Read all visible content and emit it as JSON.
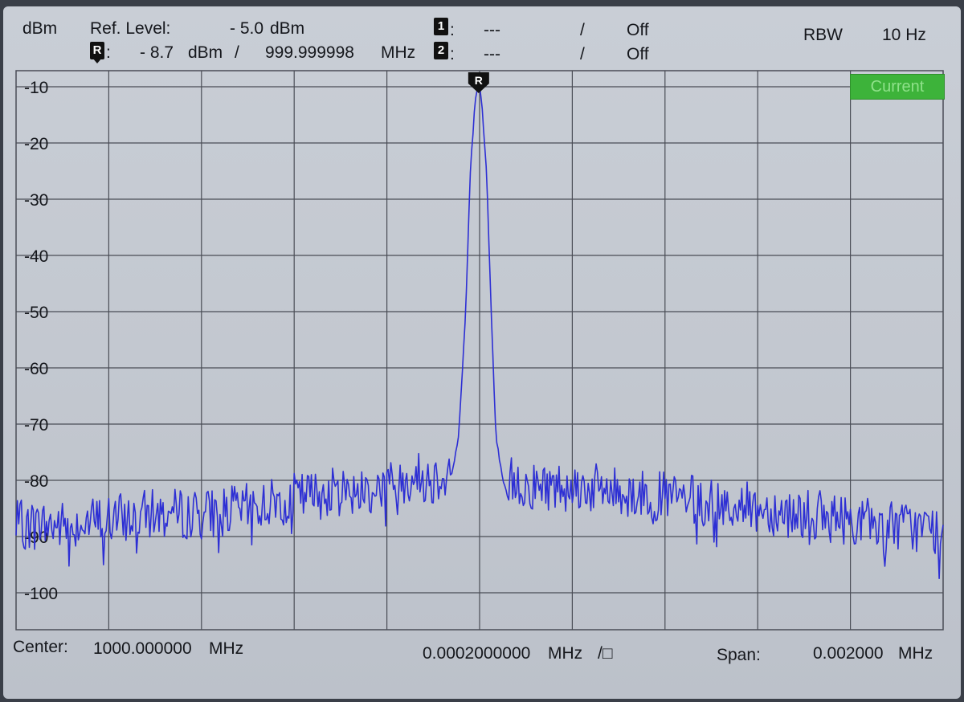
{
  "header": {
    "unit": "dBm",
    "ref_level_label": "Ref. Level:",
    "ref_level_value": "- 5.0",
    "ref_level_unit": "dBm",
    "marker_r_label": "R",
    "marker_r_colon": ":",
    "marker_r_level": "- 8.7",
    "marker_r_level_unit": "dBm",
    "marker_r_sep": "/",
    "marker_r_freq": "999.999998",
    "marker_r_freq_unit": "MHz",
    "marker1_label": "1",
    "marker1_colon": ":",
    "marker1_value": "---",
    "marker1_sep": "/",
    "marker1_state": "Off",
    "marker2_label": "2",
    "marker2_colon": ":",
    "marker2_value": "---",
    "marker2_sep": "/",
    "marker2_state": "Off",
    "rbw_label": "RBW",
    "rbw_value": "10 Hz"
  },
  "trace_badge": "Current",
  "peak_marker_label": "R",
  "footer": {
    "center_label": "Center:",
    "center_value": "1000.000000",
    "center_unit": "MHz",
    "div_value": "0.0002000000",
    "div_unit": "MHz",
    "div_suffix": "/□",
    "span_label": "Span:",
    "span_value": "0.002000",
    "span_unit": "MHz"
  },
  "colors": {
    "trace": "#2d2fd4",
    "grid": "#4a4d56",
    "background": "#c6cbd3",
    "badge": "#3db33a"
  },
  "chart_data": {
    "type": "line",
    "title": "",
    "xlabel": "",
    "ylabel": "dBm",
    "xlim": [
      999.999,
      1000.001
    ],
    "ylim": [
      -105,
      -8
    ],
    "x_unit": "MHz",
    "y_ticks": [
      "-10",
      "-20",
      "-30",
      "-40",
      "-50",
      "-60",
      "-70",
      "-80",
      "-90",
      "-100"
    ],
    "y_tick_values": [
      -10,
      -20,
      -30,
      -40,
      -50,
      -60,
      -70,
      -80,
      -90,
      -100
    ],
    "grid": true,
    "peak": {
      "x": 999.999998,
      "y": -8.7
    },
    "noise_floor_x": [
      999.999,
      999.9991,
      999.9992,
      999.9993,
      999.9994,
      999.9995,
      999.9996,
      999.9997,
      999.9998,
      999.99985,
      999.9999,
      999.99993,
      1000.00007,
      1000.0001,
      1000.00015,
      1000.0002,
      1000.0003,
      1000.0004,
      1000.0005,
      1000.0006,
      1000.0007,
      1000.0008,
      1000.0009,
      1000.001
    ],
    "noise_floor_y": [
      -88,
      -88,
      -87,
      -86,
      -86,
      -85,
      -83,
      -82,
      -81,
      -79,
      -80,
      -78,
      -80,
      -81,
      -81,
      -81,
      -82,
      -83,
      -84,
      -85,
      -86,
      -87,
      -88,
      -89
    ],
    "series": [
      {
        "x": [
          999.99994,
          999.999955,
          999.99997,
          999.99998,
          999.99999,
          999.999998,
          1000.000005,
          1000.000015,
          1000.000025,
          1000.000035,
          1000.00005,
          1000.000065
        ],
        "y": [
          -79,
          -72,
          -50,
          -25,
          -13,
          -8.7,
          -13,
          -25,
          -50,
          -72,
          -80,
          -84
        ]
      }
    ]
  }
}
